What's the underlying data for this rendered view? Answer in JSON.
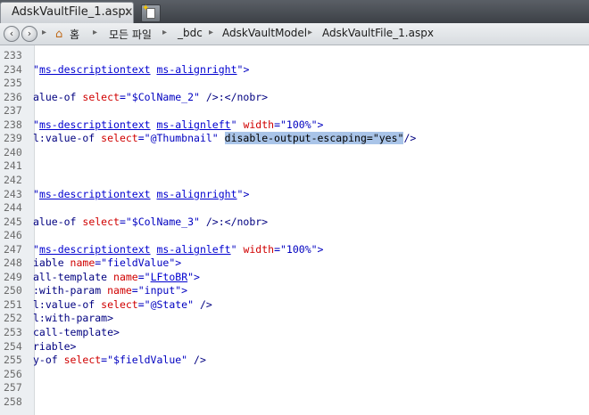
{
  "tab": {
    "title": "AdskVaultFile_1.aspx",
    "close": "×"
  },
  "nav": {
    "back": "‹",
    "forward": "›",
    "home_label": "홈",
    "crumbs": [
      "모든 파일",
      "_bdc",
      "AdskVaultModel",
      "AdskVaultFile_1.aspx"
    ]
  },
  "lines": [
    {
      "n": "233",
      "s": []
    },
    {
      "n": "234",
      "s": [
        {
          "t": "\"",
          "c": "val"
        },
        {
          "t": "ms-descriptiontext",
          "c": "link"
        },
        {
          "t": " ",
          "c": ""
        },
        {
          "t": "ms-alignright",
          "c": "link"
        },
        {
          "t": "\">",
          "c": "val"
        }
      ]
    },
    {
      "n": "235",
      "s": []
    },
    {
      "n": "236",
      "s": [
        {
          "t": "alue-of ",
          "c": "tag"
        },
        {
          "t": "select",
          "c": "attr"
        },
        {
          "t": "=\"$ColName_2\" ",
          "c": "val"
        },
        {
          "t": "/>:</nobr>",
          "c": "tag"
        }
      ]
    },
    {
      "n": "237",
      "s": []
    },
    {
      "n": "238",
      "s": [
        {
          "t": "\"",
          "c": "val"
        },
        {
          "t": "ms-descriptiontext",
          "c": "link"
        },
        {
          "t": " ",
          "c": ""
        },
        {
          "t": "ms-alignleft",
          "c": "link"
        },
        {
          "t": "\" ",
          "c": "val"
        },
        {
          "t": "width",
          "c": "attr"
        },
        {
          "t": "=\"100%\">",
          "c": "val"
        }
      ]
    },
    {
      "n": "239",
      "s": [
        {
          "t": "l:value-of ",
          "c": "tag"
        },
        {
          "t": "select",
          "c": "attr"
        },
        {
          "t": "=\"@Thumbnail\" ",
          "c": "val"
        },
        {
          "t": "disable-output-escaping=\"yes\"",
          "c": "sel"
        },
        {
          "t": "/>",
          "c": "tag"
        }
      ]
    },
    {
      "n": "240",
      "s": []
    },
    {
      "n": "241",
      "s": []
    },
    {
      "n": "242",
      "s": []
    },
    {
      "n": "243",
      "s": [
        {
          "t": "\"",
          "c": "val"
        },
        {
          "t": "ms-descriptiontext",
          "c": "link"
        },
        {
          "t": " ",
          "c": ""
        },
        {
          "t": "ms-alignright",
          "c": "link"
        },
        {
          "t": "\">",
          "c": "val"
        }
      ]
    },
    {
      "n": "244",
      "s": []
    },
    {
      "n": "245",
      "s": [
        {
          "t": "alue-of ",
          "c": "tag"
        },
        {
          "t": "select",
          "c": "attr"
        },
        {
          "t": "=\"$ColName_3\" ",
          "c": "val"
        },
        {
          "t": "/>:</nobr>",
          "c": "tag"
        }
      ]
    },
    {
      "n": "246",
      "s": []
    },
    {
      "n": "247",
      "s": [
        {
          "t": "\"",
          "c": "val"
        },
        {
          "t": "ms-descriptiontext",
          "c": "link"
        },
        {
          "t": " ",
          "c": ""
        },
        {
          "t": "ms-alignleft",
          "c": "link"
        },
        {
          "t": "\" ",
          "c": "val"
        },
        {
          "t": "width",
          "c": "attr"
        },
        {
          "t": "=\"100%\">",
          "c": "val"
        }
      ]
    },
    {
      "n": "248",
      "s": [
        {
          "t": "iable ",
          "c": "tag"
        },
        {
          "t": "name",
          "c": "attr"
        },
        {
          "t": "=\"fieldValue\">",
          "c": "val"
        }
      ]
    },
    {
      "n": "249",
      "s": [
        {
          "t": "all-template ",
          "c": "tag"
        },
        {
          "t": "name",
          "c": "attr"
        },
        {
          "t": "=\"",
          "c": "val"
        },
        {
          "t": "LFtoBR",
          "c": "link"
        },
        {
          "t": "\">",
          "c": "val"
        }
      ]
    },
    {
      "n": "250",
      "s": [
        {
          "t": ":with-param ",
          "c": "tag"
        },
        {
          "t": "name",
          "c": "attr"
        },
        {
          "t": "=\"input\">",
          "c": "val"
        }
      ]
    },
    {
      "n": "251",
      "s": [
        {
          "t": "l:value-of ",
          "c": "tag"
        },
        {
          "t": "select",
          "c": "attr"
        },
        {
          "t": "=\"@State\" ",
          "c": "val"
        },
        {
          "t": "/>",
          "c": "tag"
        }
      ]
    },
    {
      "n": "252",
      "s": [
        {
          "t": "l:with-param>",
          "c": "tag"
        }
      ]
    },
    {
      "n": "253",
      "s": [
        {
          "t": "call-template>",
          "c": "tag"
        }
      ]
    },
    {
      "n": "254",
      "s": [
        {
          "t": "riable>",
          "c": "tag"
        }
      ]
    },
    {
      "n": "255",
      "s": [
        {
          "t": "y-of ",
          "c": "tag"
        },
        {
          "t": "select",
          "c": "attr"
        },
        {
          "t": "=\"$fieldValue\" ",
          "c": "val"
        },
        {
          "t": "/>",
          "c": "tag"
        }
      ]
    },
    {
      "n": "256",
      "s": []
    },
    {
      "n": "257",
      "s": []
    },
    {
      "n": "258",
      "s": []
    }
  ]
}
